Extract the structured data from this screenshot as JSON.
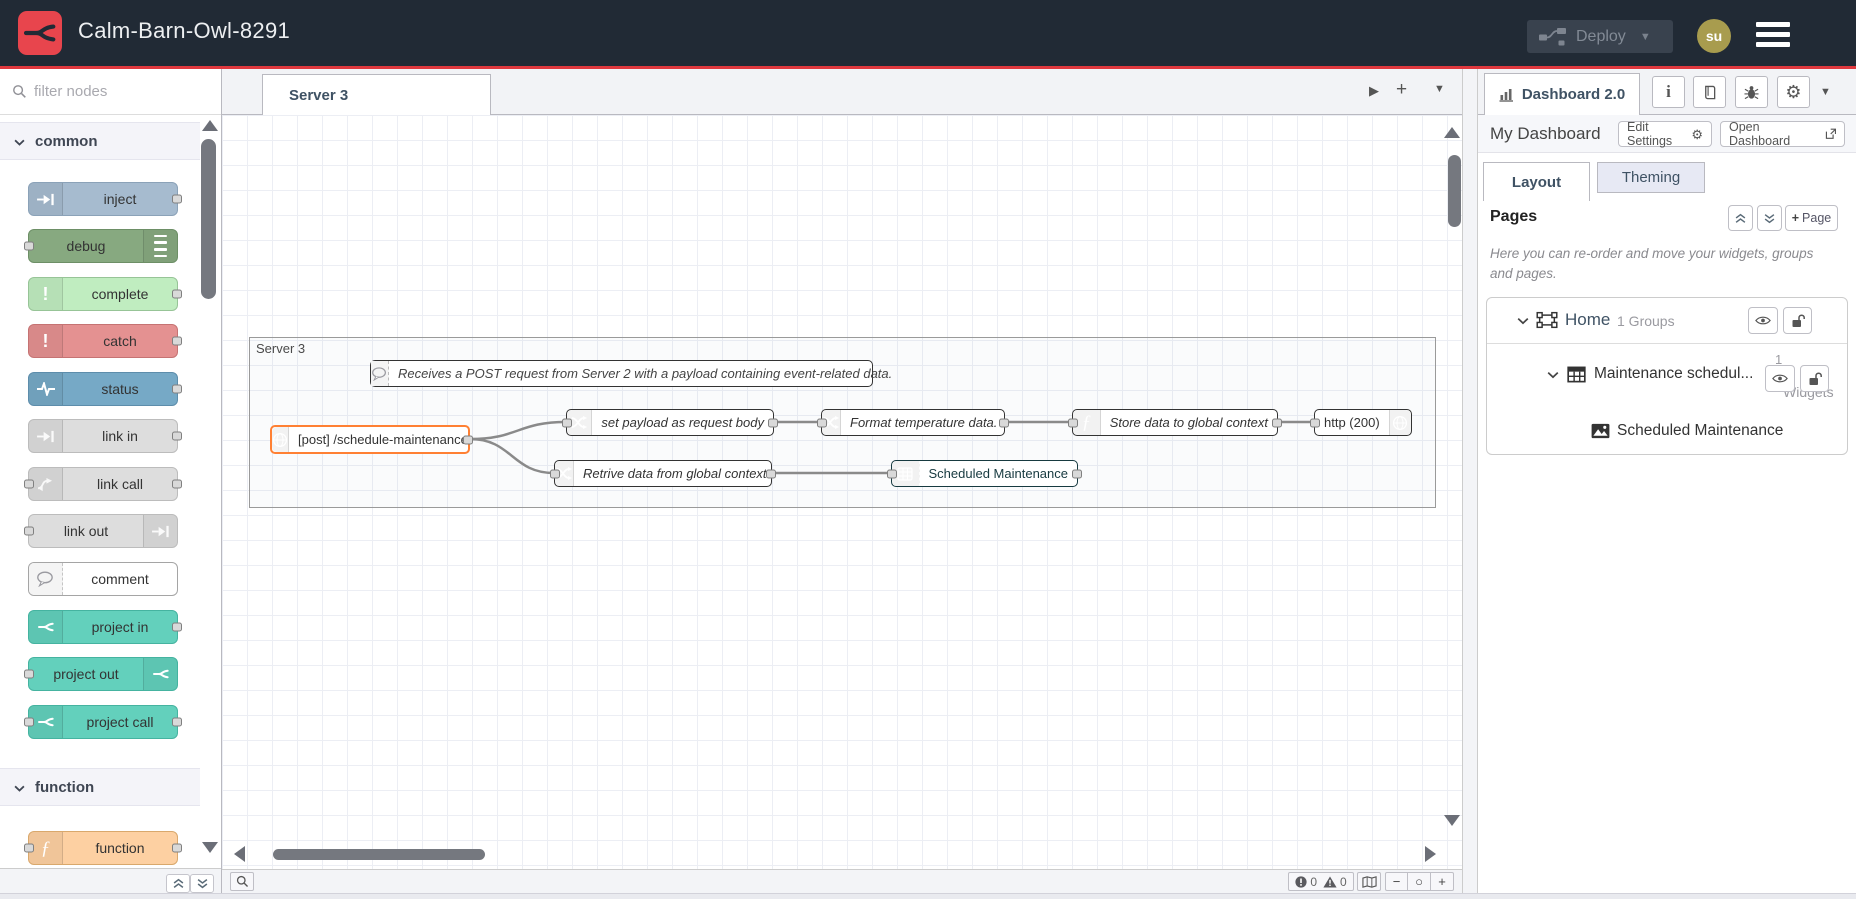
{
  "header": {
    "title": "Calm-Barn-Owl-8291",
    "deploy_label": "Deploy",
    "avatar_initials": "su"
  },
  "icons": {
    "caret_down": "▼",
    "play": "▶",
    "plus": "+",
    "minus": "−",
    "zoom_reset": "○",
    "gear": "⚙",
    "exclamation": "!",
    "function_f": "ƒ",
    "info_i": "i"
  },
  "palette": {
    "filter_placeholder": "filter nodes",
    "categories": [
      {
        "label": "common",
        "items": [
          {
            "label": "inject"
          },
          {
            "label": "debug"
          },
          {
            "label": "complete"
          },
          {
            "label": "catch"
          },
          {
            "label": "status"
          },
          {
            "label": "link in"
          },
          {
            "label": "link call"
          },
          {
            "label": "link out"
          },
          {
            "label": "comment"
          },
          {
            "label": "project in"
          },
          {
            "label": "project out"
          },
          {
            "label": "project call"
          }
        ]
      },
      {
        "label": "function",
        "items": [
          {
            "label": "function"
          }
        ]
      }
    ]
  },
  "workspace": {
    "tab_label": "Server 3",
    "group_label": "Server 3",
    "comment_text": "Receives a POST request from Server 2 with a payload containing event-related data.",
    "nodes": {
      "http_in": "[post] /schedule-maintenance",
      "set_payload": "set payload as request body",
      "format_temp": "Format temperature data.",
      "store_data": "Store data to global context",
      "http_response": "http (200)",
      "retrieve_data": "Retrive data from global context",
      "ui_table": "Scheduled Maintenance"
    }
  },
  "sidebar": {
    "tab_label": "Dashboard 2.0",
    "dashboard_name": "My Dashboard",
    "edit_settings_label": "Edit Settings",
    "open_dashboard_label": "Open Dashboard",
    "tabs": {
      "layout": "Layout",
      "theming": "Theming"
    },
    "pages": {
      "heading": "Pages",
      "add_page_label": "Page",
      "help_text": "Here you can re-order and move your widgets, groups and pages.",
      "tree": {
        "page_name": "Home",
        "page_meta": "1 Groups",
        "group_name": "Maintenance schedul...",
        "group_meta_count": "1",
        "group_meta_label": "Widgets",
        "widget_name": "Scheduled Maintenance"
      }
    }
  },
  "status_bar": {
    "error_count": "0",
    "warning_count": "0"
  },
  "colors": {
    "header_bg": "#212a35",
    "accent_red": "#e0383e",
    "logo_red": "#e8454d",
    "node_inject": "#a6bbcf",
    "node_debug": "#87a980",
    "node_complete": "#c0edc0",
    "node_catch": "#e49191",
    "node_status": "#76a9c6",
    "node_link": "#dddddd",
    "node_project": "#63d0bc",
    "node_function": "#fdd0a2",
    "node_change": "#e2d96e",
    "node_http": "#e7e7ae",
    "node_table": "#4dc4d6",
    "selection_orange": "#ff8033"
  }
}
